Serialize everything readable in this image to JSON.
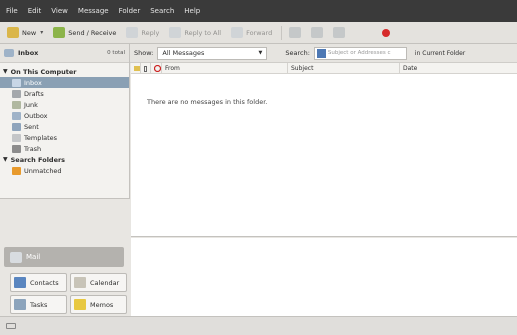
{
  "menu": [
    "File",
    "Edit",
    "View",
    "Message",
    "Folder",
    "Search",
    "Help"
  ],
  "toolbar": {
    "new_label": "New",
    "send_receive_label": "Send / Receive",
    "reply_label": "Reply",
    "reply_all_label": "Reply to All",
    "forward_label": "Forward"
  },
  "folder_header": {
    "title": "Inbox",
    "count": "0 total"
  },
  "tree": {
    "on_this_computer": "On This Computer",
    "folders": [
      "Inbox",
      "Drafts",
      "Junk",
      "Outbox",
      "Sent",
      "Templates",
      "Trash"
    ],
    "search_folders": "Search Folders",
    "search_items": [
      "Unmatched"
    ]
  },
  "switcher": {
    "mail": "Mail",
    "contacts": "Contacts",
    "calendar": "Calendar",
    "tasks": "Tasks",
    "memos": "Memos"
  },
  "filter": {
    "show_label": "Show:",
    "show_value": "All Messages",
    "search_label": "Search:",
    "search_placeholder": "Subject or Addresses c",
    "scope": "in Current Folder"
  },
  "columns": [
    "From",
    "Subject",
    "Date"
  ],
  "empty_text": "There are no messages in this folder.",
  "status_text": "",
  "colors": {
    "menubar": "#3a3a3a",
    "selected": "#8aa0b4",
    "accent": "#4d78b4",
    "delete_red": "#d62a2a"
  }
}
